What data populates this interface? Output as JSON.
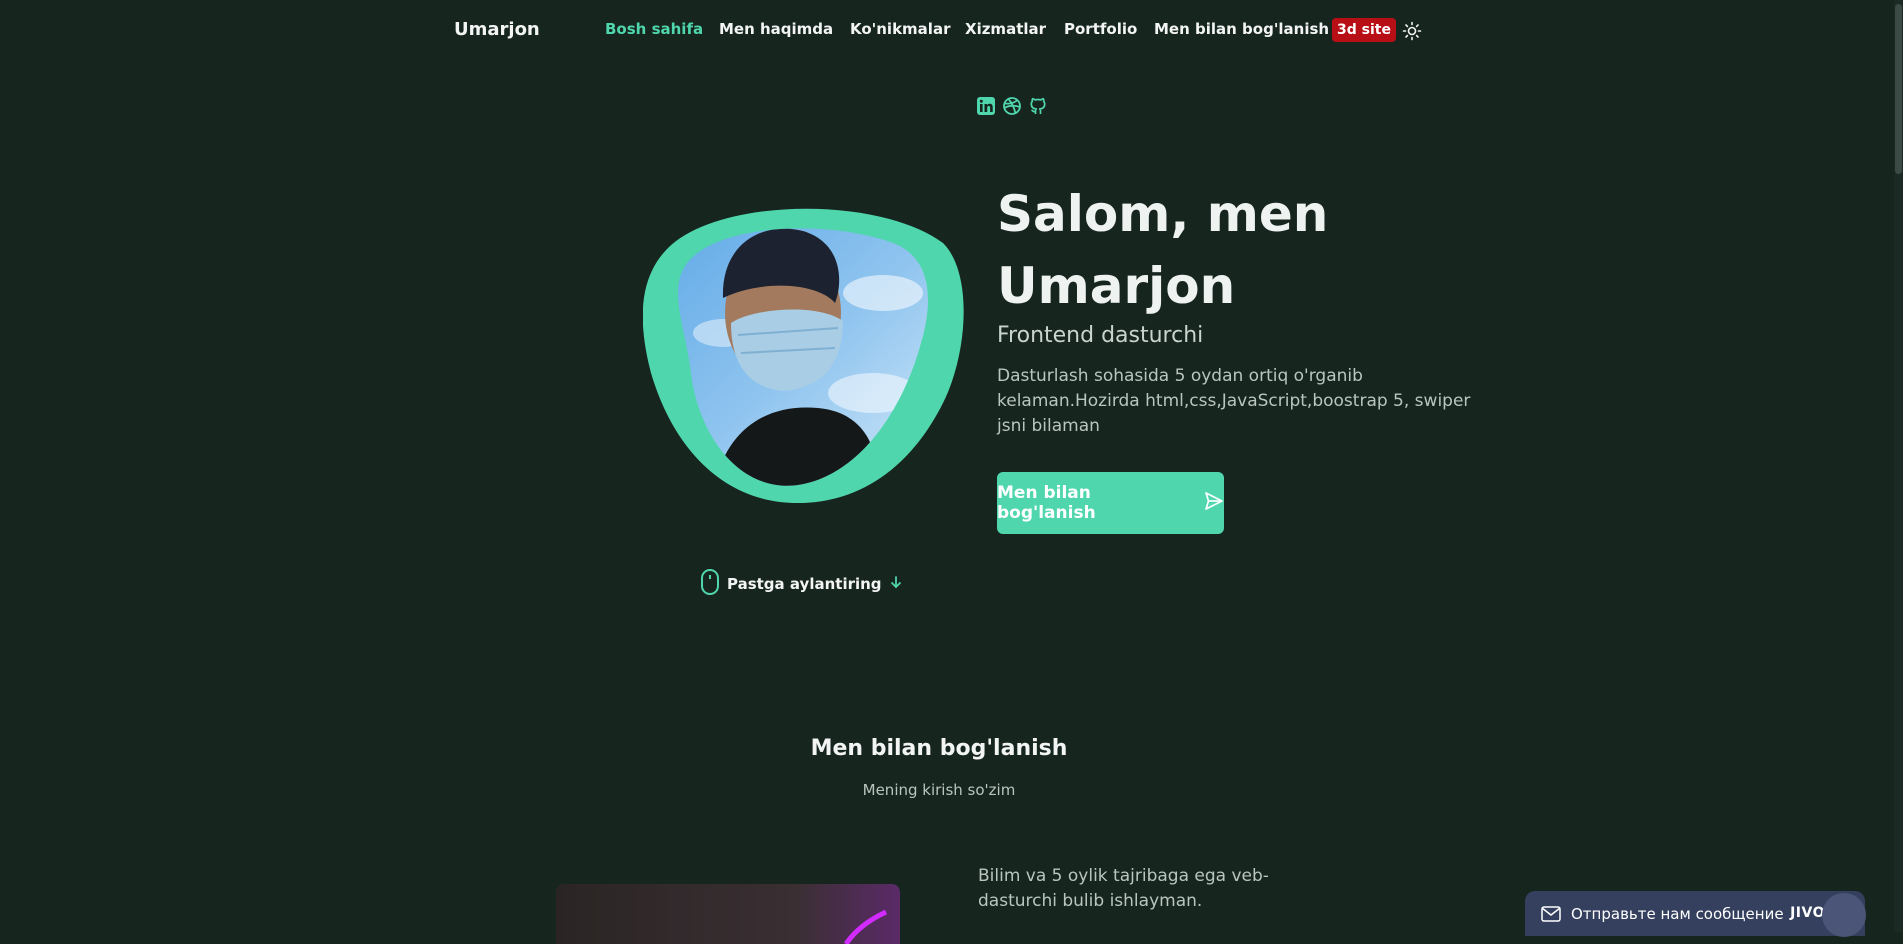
{
  "nav": {
    "logo": "Umarjon",
    "items": [
      {
        "label": "Bosh sahifa",
        "active": true
      },
      {
        "label": "Men haqimda",
        "active": false
      },
      {
        "label": "Ko'nikmalar",
        "active": false
      },
      {
        "label": "Xizmatlar",
        "active": false
      },
      {
        "label": "Portfolio",
        "active": false
      },
      {
        "label": "Men bilan bog'lanish",
        "active": false
      }
    ],
    "badge": "3d site",
    "theme_icon": "sun-icon"
  },
  "social": [
    "linkedin-icon",
    "dribbble-icon",
    "github-icon"
  ],
  "hero": {
    "title": "Salom, men Umarjon",
    "subtitle": "Frontend dasturchi",
    "description": "Dasturlash sohasida 5 oydan ortiq o'rganib kelaman.Hozirda html,css,JavaScript,boostrap 5, swiper jsni bilaman",
    "cta_label": "Men bilan bog'lanish",
    "scroll_label": "Pastga aylantiring"
  },
  "section": {
    "title": "Men bilan bog'lanish",
    "subtitle": "Mening kirish so'zim",
    "about_text": "Bilim va 5 oylik tajribaga ega veb-dasturchi bulib ishlayman."
  },
  "chat": {
    "label": "Отправьте нам сообщение",
    "brand": "JIVO"
  },
  "colors": {
    "background": "#17251f",
    "accent": "#4fd6ac",
    "badge": "#b80f16"
  }
}
